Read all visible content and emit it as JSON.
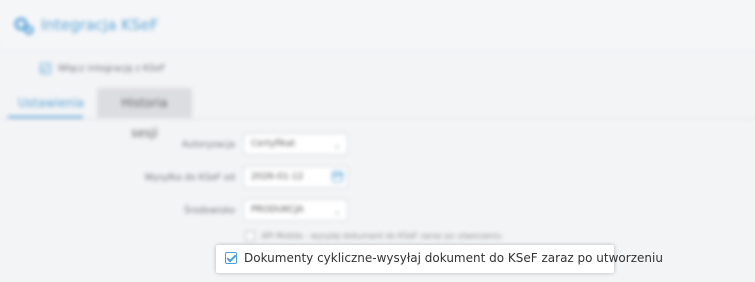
{
  "header": {
    "title": "Integracja KSeF",
    "icon": "gears-icon",
    "accent": "#5aa3d6"
  },
  "enable": {
    "label": "Włącz integrację z KSeF",
    "checked": true
  },
  "tabs": [
    {
      "label": "Ustawienia",
      "active": true
    },
    {
      "label": "Historia sesji",
      "active": false
    }
  ],
  "form": {
    "authorization": {
      "label": "Autoryzacja",
      "value": "Certyfikat"
    },
    "send_from": {
      "label": "Wysyłka do KSeF od",
      "value": "2026-01-12"
    },
    "environment": {
      "label": "Środowisko",
      "value": "PRODUKCJA"
    },
    "mobile_option": {
      "label": "APi Mobile - wysyłaj dokument do KSeF zaraz po utworzeniu",
      "checked": false
    }
  },
  "highlight": {
    "label": "Dokumenty cykliczne-wysyłaj dokument do KSeF zaraz po utworzeniu",
    "checked": true,
    "accent": "#4aa0d8"
  }
}
